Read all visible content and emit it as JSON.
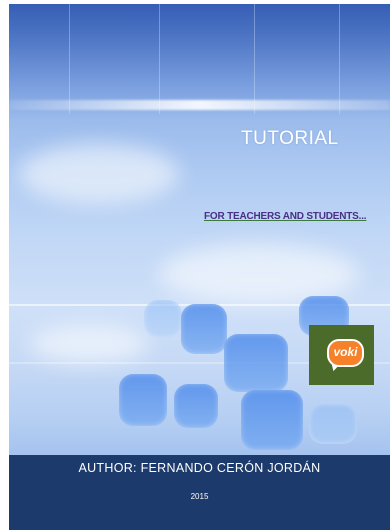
{
  "cover": {
    "title": "TUTORIAL",
    "subtitle": "FOR TEACHERS  AND STUDENTS...",
    "logo_text": "voki",
    "author": "AUTHOR: FERNANDO CERÓN JORDÁN",
    "year": "2015"
  },
  "colors": {
    "footer_bg": "#1c3a6b",
    "logo_bg": "#4a6b2a",
    "logo_bubble": "#f5812a",
    "subtitle": "#4a2f86"
  }
}
